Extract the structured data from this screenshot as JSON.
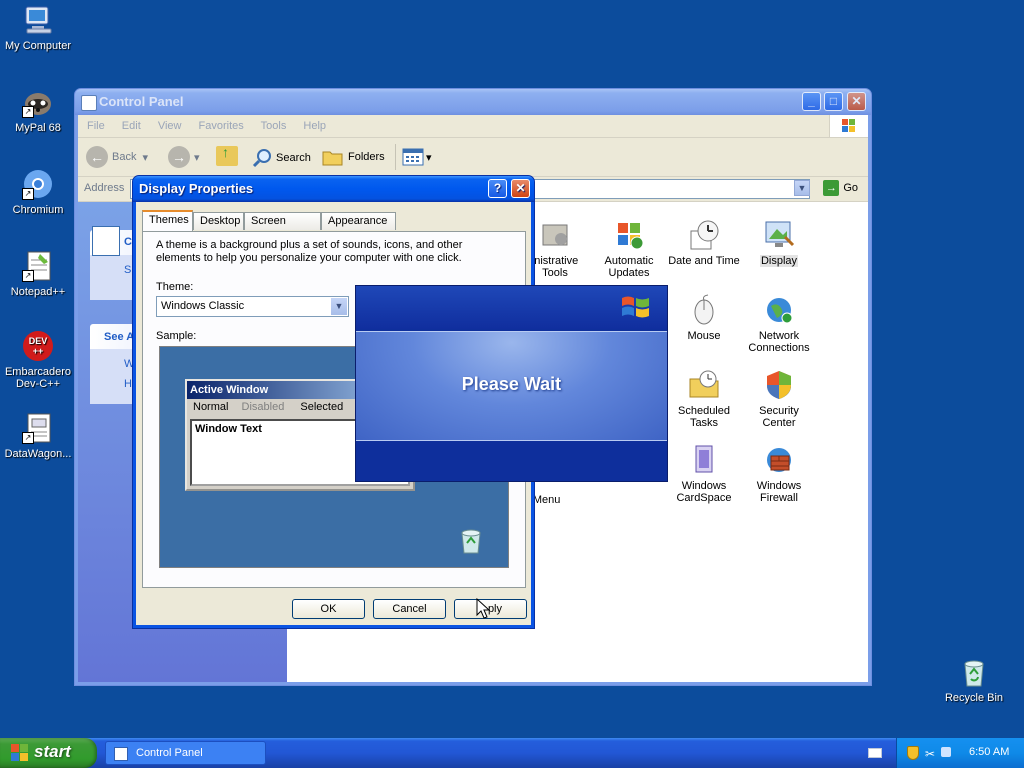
{
  "desktop": {
    "icons": [
      {
        "label": "My Computer"
      },
      {
        "label": "MyPal 68"
      },
      {
        "label": "Chromium"
      },
      {
        "label": "Notepad++"
      },
      {
        "label": "Embarcadero Dev-C++"
      },
      {
        "label": "DataWagon..."
      }
    ],
    "recycle_bin": "Recycle Bin",
    "dev_badge": "DEV",
    "dev_badge2": "++"
  },
  "control_panel": {
    "title": "Control Panel",
    "menu": [
      "File",
      "Edit",
      "View",
      "Favorites",
      "Tools",
      "Help"
    ],
    "toolbar": {
      "back": "Back",
      "search": "Search",
      "folders": "Folders"
    },
    "address_label": "Address",
    "go_label": "Go",
    "side": {
      "panel1_title_partial": "Co",
      "panel1_item_partial": "S",
      "panel2_title_partial": "See A",
      "panel2_item1_partial": "W",
      "panel2_item2_partial": "H"
    },
    "items": [
      {
        "label": "Administrative Tools",
        "display": "inistrative\nTools"
      },
      {
        "label": "Automatic Updates",
        "display": "Automatic\nUpdates"
      },
      {
        "label": "Date and Time",
        "display": "Date and Time"
      },
      {
        "label": "Display",
        "display": "Display"
      },
      {
        "label": "Mouse",
        "display": "Mouse"
      },
      {
        "label": "Network Connections",
        "display": "Network\nConnections"
      },
      {
        "label": "Scheduled Tasks",
        "display": "Scheduled\nTasks"
      },
      {
        "label": "Security Center",
        "display": "Security\nCenter"
      },
      {
        "label": "Windows CardSpace",
        "display": "Windows\nCardSpace"
      },
      {
        "label": "Windows Firewall",
        "display": "Windows\nFirewall"
      },
      {
        "label": "Taskbar and Start Menu",
        "display": "art Menu"
      }
    ]
  },
  "display_properties": {
    "title": "Display Properties",
    "tabs": [
      "Themes",
      "Desktop",
      "Screen Saver",
      "Appearance"
    ],
    "description": "A theme is a background plus a set of sounds, icons, and other elements to help you personalize your computer with one click.",
    "theme_label": "Theme:",
    "theme_value": "Windows Classic",
    "sample_label": "Sample:",
    "sample": {
      "active_window": "Active Window",
      "menu": [
        "Normal",
        "Disabled",
        "Selected"
      ],
      "window_text": "Window Text"
    },
    "buttons": {
      "ok": "OK",
      "cancel": "Cancel",
      "apply": "Apply",
      "apply_visible": "ply"
    }
  },
  "please_wait": {
    "message": "Please Wait"
  },
  "taskbar": {
    "start": "start",
    "task": "Control Panel",
    "clock": "6:50 AM"
  },
  "colors": {
    "desktop": "#0c4c9c",
    "xp_blue": "#0054e3",
    "start_green": "#3c9a36",
    "tab_highlight": "#e68b2c"
  }
}
